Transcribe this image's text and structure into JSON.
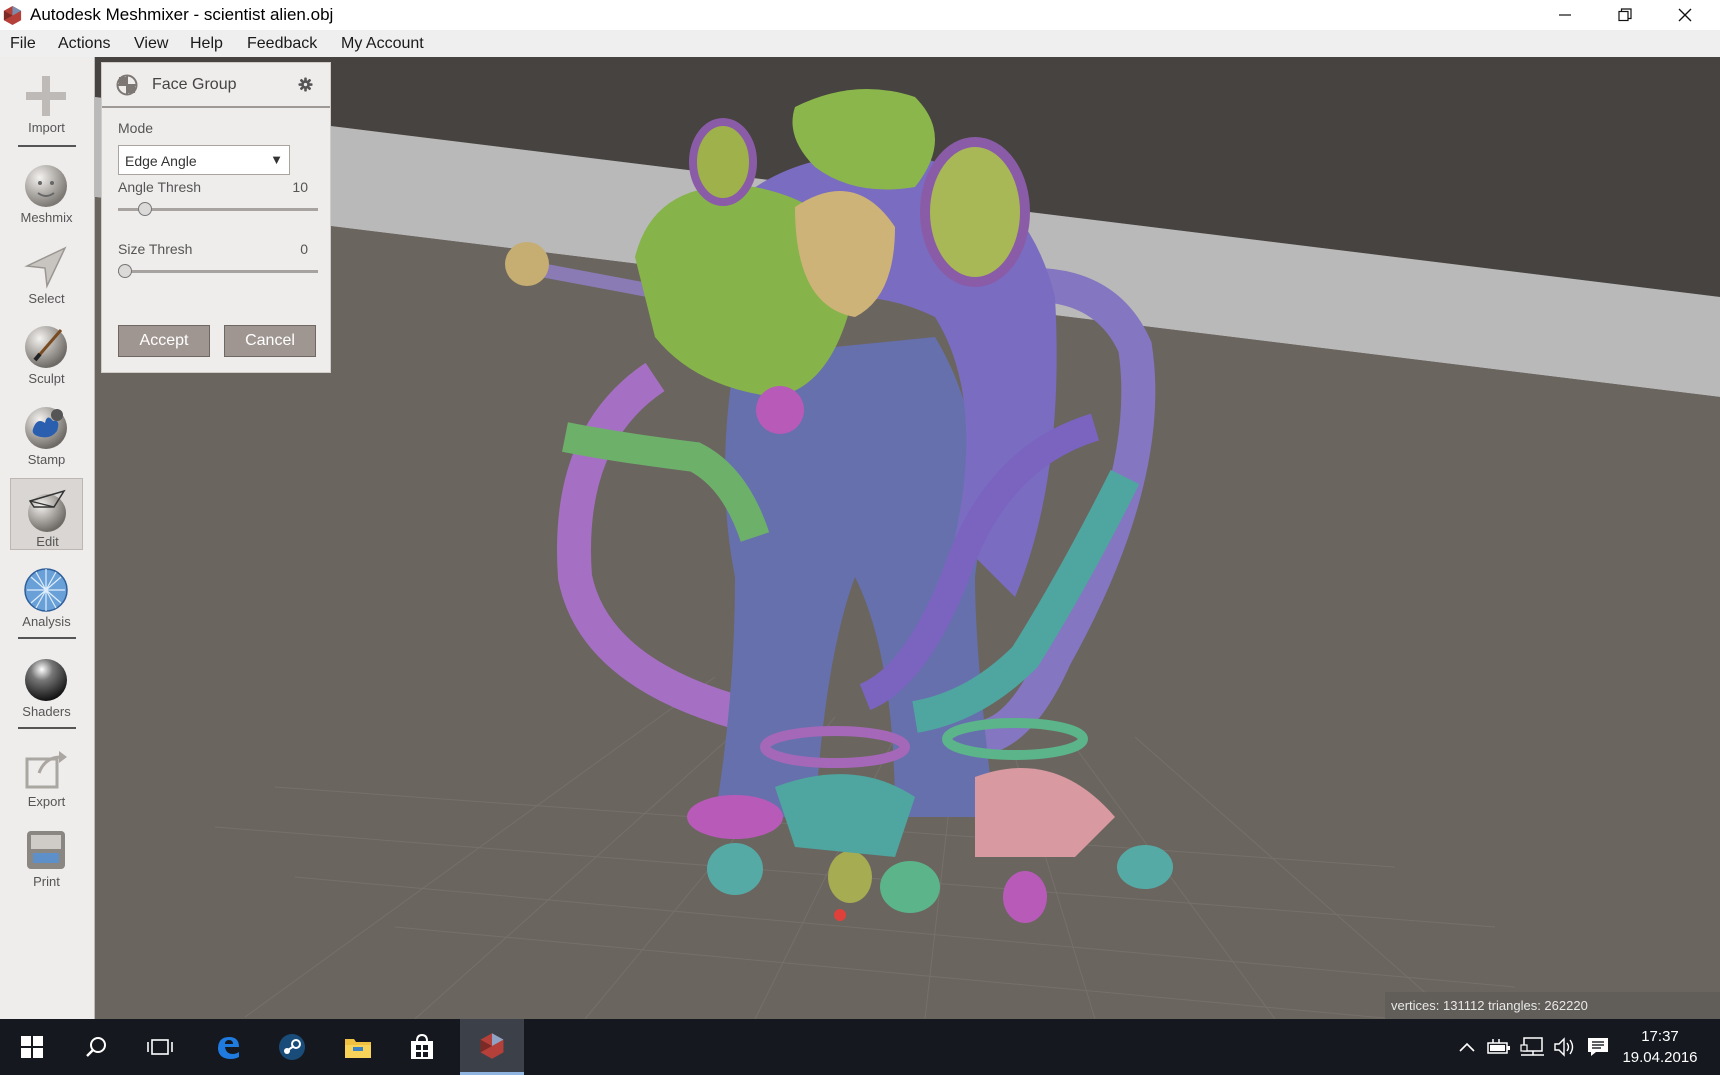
{
  "window": {
    "title": "Autodesk Meshmixer - scientist alien.obj",
    "controls": [
      "minimize-icon",
      "restore-icon",
      "close-icon"
    ]
  },
  "menu": [
    "File",
    "Actions",
    "View",
    "Help",
    "Feedback",
    "My Account"
  ],
  "toolbar": {
    "items": [
      {
        "label": "Import",
        "icon": "import-icon"
      },
      {
        "label": "Meshmix",
        "icon": "meshmix-icon"
      },
      {
        "label": "Select",
        "icon": "select-icon"
      },
      {
        "label": "Sculpt",
        "icon": "sculpt-icon"
      },
      {
        "label": "Stamp",
        "icon": "stamp-icon"
      },
      {
        "label": "Edit",
        "icon": "edit-icon",
        "active": true
      },
      {
        "label": "Analysis",
        "icon": "analysis-icon"
      },
      {
        "label": "Shaders",
        "icon": "shaders-icon"
      },
      {
        "label": "Export",
        "icon": "export-icon"
      },
      {
        "label": "Print",
        "icon": "print-icon"
      }
    ]
  },
  "panel": {
    "title": "Face Group",
    "mode_label": "Mode",
    "mode_value": "Edge Angle",
    "angle_label": "Angle Thresh",
    "angle_value": "10",
    "angle_fraction": 0.11,
    "size_label": "Size Thresh",
    "size_value": "0",
    "size_fraction": 0.0,
    "accept": "Accept",
    "cancel": "Cancel"
  },
  "status": "vertices: 131112 triangles: 262220",
  "taskbar": {
    "apps": [
      "windows-start-icon",
      "search-icon",
      "task-view-icon",
      "edge-icon",
      "steam-icon",
      "file-explorer-icon",
      "store-icon",
      "meshmixer-icon"
    ],
    "tray": [
      "chevron-up-icon",
      "battery-icon",
      "network-icon",
      "volume-icon",
      "notification-icon"
    ],
    "time": "17:37",
    "date": "19.04.2016"
  },
  "colors": {
    "viewport_bg": "#6b6560",
    "wall": "#b9b9b9",
    "panel_bg": "#eeedec",
    "button": "#9f9691",
    "taskbar": "#15191f"
  }
}
